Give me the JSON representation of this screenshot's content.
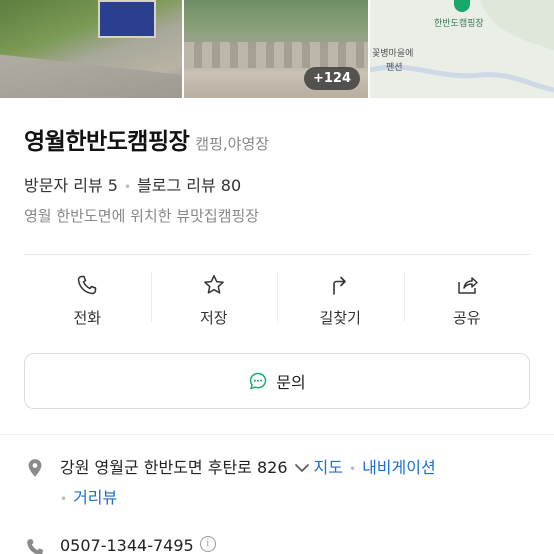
{
  "photos": {
    "more_count": "+124",
    "map_labels": [
      "한반도캠핑장",
      "꽃병마을에",
      "펜션"
    ]
  },
  "place": {
    "name": "영월한반도캠핑장",
    "category": "캠핑,야영장",
    "visitor_reviews": "방문자 리뷰 5",
    "blog_reviews": "블로그 리뷰 80",
    "description": "영월 한반도면에 위치한 뷰맛집캠핑장"
  },
  "actions": [
    {
      "label": "전화",
      "icon": "phone-icon"
    },
    {
      "label": "저장",
      "icon": "star-icon"
    },
    {
      "label": "길찾기",
      "icon": "directions-icon"
    },
    {
      "label": "공유",
      "icon": "share-icon"
    }
  ],
  "inquiry": {
    "label": "문의",
    "icon": "chat-icon"
  },
  "info": {
    "address": "강원 영월군 한반도면 후탄로 826",
    "map_link": "지도",
    "navigation_link": "내비게이션",
    "street_view_link": "거리뷰",
    "phone": "0507-1344-7495"
  },
  "colors": {
    "accent_green": "#17a86b",
    "link_blue": "#1b6fd1"
  }
}
